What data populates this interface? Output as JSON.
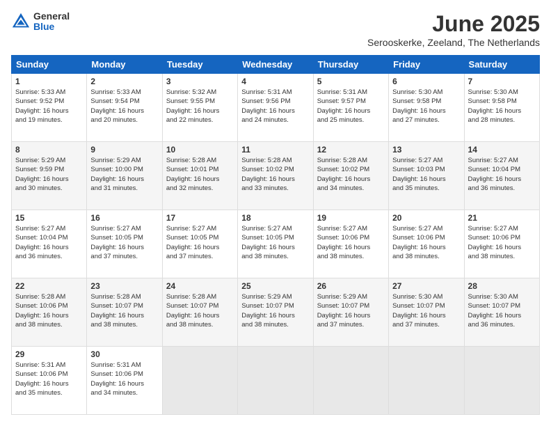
{
  "logo": {
    "general": "General",
    "blue": "Blue"
  },
  "title": "June 2025",
  "location": "Serooskerke, Zeeland, The Netherlands",
  "days_of_week": [
    "Sunday",
    "Monday",
    "Tuesday",
    "Wednesday",
    "Thursday",
    "Friday",
    "Saturday"
  ],
  "weeks": [
    [
      {
        "day": "1",
        "info": "Sunrise: 5:33 AM\nSunset: 9:52 PM\nDaylight: 16 hours\nand 19 minutes."
      },
      {
        "day": "2",
        "info": "Sunrise: 5:33 AM\nSunset: 9:54 PM\nDaylight: 16 hours\nand 20 minutes."
      },
      {
        "day": "3",
        "info": "Sunrise: 5:32 AM\nSunset: 9:55 PM\nDaylight: 16 hours\nand 22 minutes."
      },
      {
        "day": "4",
        "info": "Sunrise: 5:31 AM\nSunset: 9:56 PM\nDaylight: 16 hours\nand 24 minutes."
      },
      {
        "day": "5",
        "info": "Sunrise: 5:31 AM\nSunset: 9:57 PM\nDaylight: 16 hours\nand 25 minutes."
      },
      {
        "day": "6",
        "info": "Sunrise: 5:30 AM\nSunset: 9:58 PM\nDaylight: 16 hours\nand 27 minutes."
      },
      {
        "day": "7",
        "info": "Sunrise: 5:30 AM\nSunset: 9:58 PM\nDaylight: 16 hours\nand 28 minutes."
      }
    ],
    [
      {
        "day": "8",
        "info": "Sunrise: 5:29 AM\nSunset: 9:59 PM\nDaylight: 16 hours\nand 30 minutes."
      },
      {
        "day": "9",
        "info": "Sunrise: 5:29 AM\nSunset: 10:00 PM\nDaylight: 16 hours\nand 31 minutes."
      },
      {
        "day": "10",
        "info": "Sunrise: 5:28 AM\nSunset: 10:01 PM\nDaylight: 16 hours\nand 32 minutes."
      },
      {
        "day": "11",
        "info": "Sunrise: 5:28 AM\nSunset: 10:02 PM\nDaylight: 16 hours\nand 33 minutes."
      },
      {
        "day": "12",
        "info": "Sunrise: 5:28 AM\nSunset: 10:02 PM\nDaylight: 16 hours\nand 34 minutes."
      },
      {
        "day": "13",
        "info": "Sunrise: 5:27 AM\nSunset: 10:03 PM\nDaylight: 16 hours\nand 35 minutes."
      },
      {
        "day": "14",
        "info": "Sunrise: 5:27 AM\nSunset: 10:04 PM\nDaylight: 16 hours\nand 36 minutes."
      }
    ],
    [
      {
        "day": "15",
        "info": "Sunrise: 5:27 AM\nSunset: 10:04 PM\nDaylight: 16 hours\nand 36 minutes."
      },
      {
        "day": "16",
        "info": "Sunrise: 5:27 AM\nSunset: 10:05 PM\nDaylight: 16 hours\nand 37 minutes."
      },
      {
        "day": "17",
        "info": "Sunrise: 5:27 AM\nSunset: 10:05 PM\nDaylight: 16 hours\nand 37 minutes."
      },
      {
        "day": "18",
        "info": "Sunrise: 5:27 AM\nSunset: 10:05 PM\nDaylight: 16 hours\nand 38 minutes."
      },
      {
        "day": "19",
        "info": "Sunrise: 5:27 AM\nSunset: 10:06 PM\nDaylight: 16 hours\nand 38 minutes."
      },
      {
        "day": "20",
        "info": "Sunrise: 5:27 AM\nSunset: 10:06 PM\nDaylight: 16 hours\nand 38 minutes."
      },
      {
        "day": "21",
        "info": "Sunrise: 5:27 AM\nSunset: 10:06 PM\nDaylight: 16 hours\nand 38 minutes."
      }
    ],
    [
      {
        "day": "22",
        "info": "Sunrise: 5:28 AM\nSunset: 10:06 PM\nDaylight: 16 hours\nand 38 minutes."
      },
      {
        "day": "23",
        "info": "Sunrise: 5:28 AM\nSunset: 10:07 PM\nDaylight: 16 hours\nand 38 minutes."
      },
      {
        "day": "24",
        "info": "Sunrise: 5:28 AM\nSunset: 10:07 PM\nDaylight: 16 hours\nand 38 minutes."
      },
      {
        "day": "25",
        "info": "Sunrise: 5:29 AM\nSunset: 10:07 PM\nDaylight: 16 hours\nand 38 minutes."
      },
      {
        "day": "26",
        "info": "Sunrise: 5:29 AM\nSunset: 10:07 PM\nDaylight: 16 hours\nand 37 minutes."
      },
      {
        "day": "27",
        "info": "Sunrise: 5:30 AM\nSunset: 10:07 PM\nDaylight: 16 hours\nand 37 minutes."
      },
      {
        "day": "28",
        "info": "Sunrise: 5:30 AM\nSunset: 10:07 PM\nDaylight: 16 hours\nand 36 minutes."
      }
    ],
    [
      {
        "day": "29",
        "info": "Sunrise: 5:31 AM\nSunset: 10:06 PM\nDaylight: 16 hours\nand 35 minutes."
      },
      {
        "day": "30",
        "info": "Sunrise: 5:31 AM\nSunset: 10:06 PM\nDaylight: 16 hours\nand 34 minutes."
      },
      {
        "day": "",
        "info": ""
      },
      {
        "day": "",
        "info": ""
      },
      {
        "day": "",
        "info": ""
      },
      {
        "day": "",
        "info": ""
      },
      {
        "day": "",
        "info": ""
      }
    ]
  ]
}
